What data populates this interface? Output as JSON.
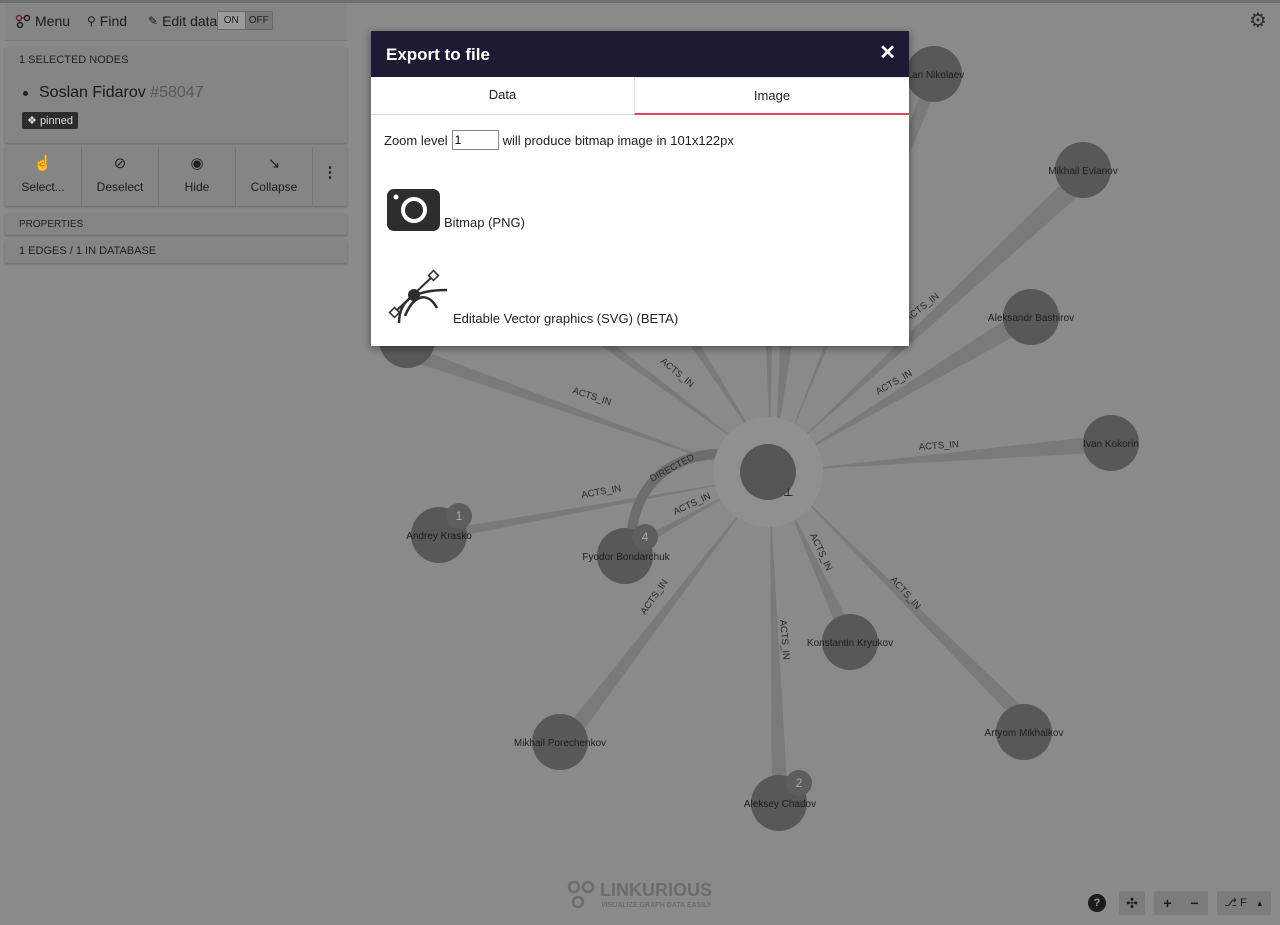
{
  "toolbar": {
    "menu_label": "Menu",
    "find_label": "Find",
    "edit_label": "Edit data",
    "toggle_on": "ON",
    "toggle_off": "OFF"
  },
  "selection": {
    "header": "1 SELECTED NODES",
    "node_name": "Soslan Fidarov",
    "node_id": "#58047",
    "badge": "pinned"
  },
  "actions": [
    {
      "label": "Select...",
      "icon": "select-hand-icon"
    },
    {
      "label": "Deselect",
      "icon": "deselect-icon"
    },
    {
      "label": "Hide",
      "icon": "hide-eye-icon"
    },
    {
      "label": "Collapse",
      "icon": "collapse-icon"
    }
  ],
  "properties_label": "PROPERTIES",
  "edges_label": "1 EDGES / 1 IN DATABASE",
  "graph": {
    "edge_type": "ACTS_IN",
    "directed_type": "DIRECTED",
    "nodes": [
      {
        "name": "Andrey Krasko",
        "badge": "1"
      },
      {
        "name": "Fyodor Bondarchuk",
        "badge": "4"
      },
      {
        "name": "Mikhail Porechenkov"
      },
      {
        "name": "Aleksey Chadov",
        "badge": "2"
      },
      {
        "name": "Konstantin Kryukov"
      },
      {
        "name": "Artyom Mikhalkov"
      },
      {
        "name": "Ivan Kokorin"
      },
      {
        "name": "Aleksandr Bashirov"
      },
      {
        "name": "Mikhail Evlanov"
      },
      {
        "name": "...an Nikolaev"
      }
    ]
  },
  "modal": {
    "title": "Export to file",
    "close": "✕",
    "tabs": [
      "Data",
      "Image"
    ],
    "active_tab": "Image",
    "zoom_label": "Zoom level",
    "zoom_value": "1",
    "zoom_suffix": "will produce bitmap image in 101x122px",
    "png_label": "Bitmap (PNG)",
    "svg_label": "Editable Vector graphics (SVG) (BETA)"
  },
  "controls": {
    "help": "?",
    "plus": "+",
    "minus": "−",
    "layout": "F"
  },
  "logo": {
    "name": "LINKURIOUS",
    "tagline": "VISUALIZE GRAPH DATA EASILY"
  }
}
